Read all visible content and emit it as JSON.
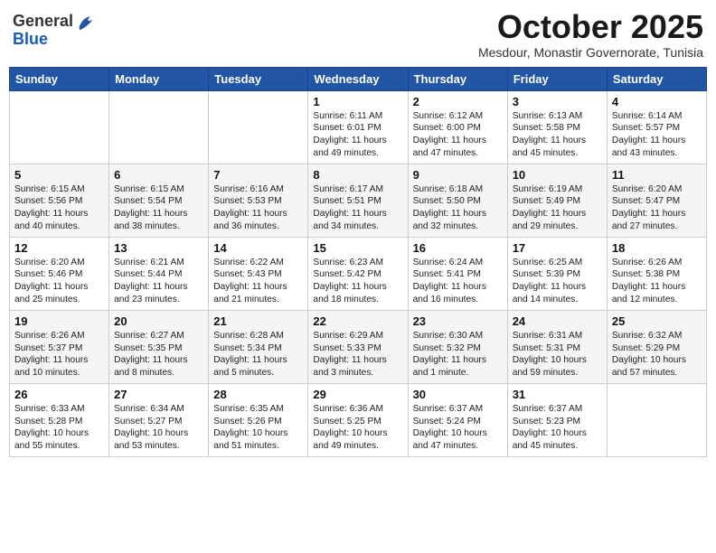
{
  "logo": {
    "general": "General",
    "blue": "Blue"
  },
  "title": "October 2025",
  "subtitle": "Mesdour, Monastir Governorate, Tunisia",
  "weekdays": [
    "Sunday",
    "Monday",
    "Tuesday",
    "Wednesday",
    "Thursday",
    "Friday",
    "Saturday"
  ],
  "weeks": [
    [
      {
        "day": "",
        "detail": ""
      },
      {
        "day": "",
        "detail": ""
      },
      {
        "day": "",
        "detail": ""
      },
      {
        "day": "1",
        "detail": "Sunrise: 6:11 AM\nSunset: 6:01 PM\nDaylight: 11 hours\nand 49 minutes."
      },
      {
        "day": "2",
        "detail": "Sunrise: 6:12 AM\nSunset: 6:00 PM\nDaylight: 11 hours\nand 47 minutes."
      },
      {
        "day": "3",
        "detail": "Sunrise: 6:13 AM\nSunset: 5:58 PM\nDaylight: 11 hours\nand 45 minutes."
      },
      {
        "day": "4",
        "detail": "Sunrise: 6:14 AM\nSunset: 5:57 PM\nDaylight: 11 hours\nand 43 minutes."
      }
    ],
    [
      {
        "day": "5",
        "detail": "Sunrise: 6:15 AM\nSunset: 5:56 PM\nDaylight: 11 hours\nand 40 minutes."
      },
      {
        "day": "6",
        "detail": "Sunrise: 6:15 AM\nSunset: 5:54 PM\nDaylight: 11 hours\nand 38 minutes."
      },
      {
        "day": "7",
        "detail": "Sunrise: 6:16 AM\nSunset: 5:53 PM\nDaylight: 11 hours\nand 36 minutes."
      },
      {
        "day": "8",
        "detail": "Sunrise: 6:17 AM\nSunset: 5:51 PM\nDaylight: 11 hours\nand 34 minutes."
      },
      {
        "day": "9",
        "detail": "Sunrise: 6:18 AM\nSunset: 5:50 PM\nDaylight: 11 hours\nand 32 minutes."
      },
      {
        "day": "10",
        "detail": "Sunrise: 6:19 AM\nSunset: 5:49 PM\nDaylight: 11 hours\nand 29 minutes."
      },
      {
        "day": "11",
        "detail": "Sunrise: 6:20 AM\nSunset: 5:47 PM\nDaylight: 11 hours\nand 27 minutes."
      }
    ],
    [
      {
        "day": "12",
        "detail": "Sunrise: 6:20 AM\nSunset: 5:46 PM\nDaylight: 11 hours\nand 25 minutes."
      },
      {
        "day": "13",
        "detail": "Sunrise: 6:21 AM\nSunset: 5:44 PM\nDaylight: 11 hours\nand 23 minutes."
      },
      {
        "day": "14",
        "detail": "Sunrise: 6:22 AM\nSunset: 5:43 PM\nDaylight: 11 hours\nand 21 minutes."
      },
      {
        "day": "15",
        "detail": "Sunrise: 6:23 AM\nSunset: 5:42 PM\nDaylight: 11 hours\nand 18 minutes."
      },
      {
        "day": "16",
        "detail": "Sunrise: 6:24 AM\nSunset: 5:41 PM\nDaylight: 11 hours\nand 16 minutes."
      },
      {
        "day": "17",
        "detail": "Sunrise: 6:25 AM\nSunset: 5:39 PM\nDaylight: 11 hours\nand 14 minutes."
      },
      {
        "day": "18",
        "detail": "Sunrise: 6:26 AM\nSunset: 5:38 PM\nDaylight: 11 hours\nand 12 minutes."
      }
    ],
    [
      {
        "day": "19",
        "detail": "Sunrise: 6:26 AM\nSunset: 5:37 PM\nDaylight: 11 hours\nand 10 minutes."
      },
      {
        "day": "20",
        "detail": "Sunrise: 6:27 AM\nSunset: 5:35 PM\nDaylight: 11 hours\nand 8 minutes."
      },
      {
        "day": "21",
        "detail": "Sunrise: 6:28 AM\nSunset: 5:34 PM\nDaylight: 11 hours\nand 5 minutes."
      },
      {
        "day": "22",
        "detail": "Sunrise: 6:29 AM\nSunset: 5:33 PM\nDaylight: 11 hours\nand 3 minutes."
      },
      {
        "day": "23",
        "detail": "Sunrise: 6:30 AM\nSunset: 5:32 PM\nDaylight: 11 hours\nand 1 minute."
      },
      {
        "day": "24",
        "detail": "Sunrise: 6:31 AM\nSunset: 5:31 PM\nDaylight: 10 hours\nand 59 minutes."
      },
      {
        "day": "25",
        "detail": "Sunrise: 6:32 AM\nSunset: 5:29 PM\nDaylight: 10 hours\nand 57 minutes."
      }
    ],
    [
      {
        "day": "26",
        "detail": "Sunrise: 6:33 AM\nSunset: 5:28 PM\nDaylight: 10 hours\nand 55 minutes."
      },
      {
        "day": "27",
        "detail": "Sunrise: 6:34 AM\nSunset: 5:27 PM\nDaylight: 10 hours\nand 53 minutes."
      },
      {
        "day": "28",
        "detail": "Sunrise: 6:35 AM\nSunset: 5:26 PM\nDaylight: 10 hours\nand 51 minutes."
      },
      {
        "day": "29",
        "detail": "Sunrise: 6:36 AM\nSunset: 5:25 PM\nDaylight: 10 hours\nand 49 minutes."
      },
      {
        "day": "30",
        "detail": "Sunrise: 6:37 AM\nSunset: 5:24 PM\nDaylight: 10 hours\nand 47 minutes."
      },
      {
        "day": "31",
        "detail": "Sunrise: 6:37 AM\nSunset: 5:23 PM\nDaylight: 10 hours\nand 45 minutes."
      },
      {
        "day": "",
        "detail": ""
      }
    ]
  ]
}
